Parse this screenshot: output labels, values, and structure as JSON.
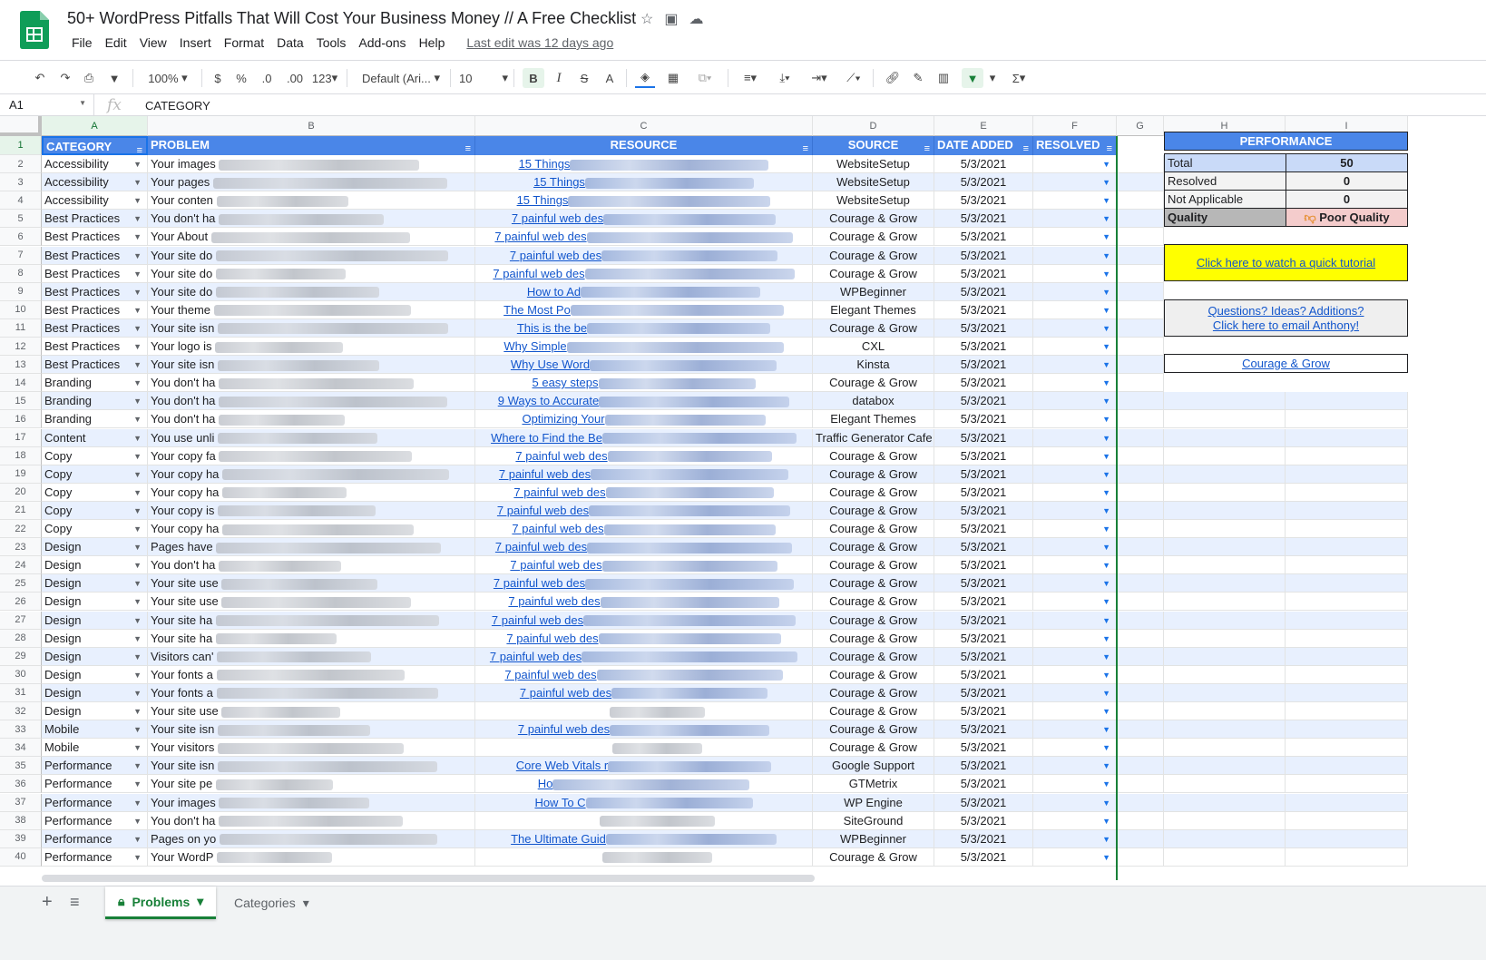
{
  "app": {
    "title": "50+ WordPress Pitfalls That Will Cost Your Business Money // A Free Checklist",
    "menu": [
      "File",
      "Edit",
      "View",
      "Insert",
      "Format",
      "Data",
      "Tools",
      "Add-ons",
      "Help"
    ],
    "last_edit": "Last edit was 12 days ago"
  },
  "toolbar": {
    "zoom": "100%",
    "currency": "$",
    "percent": "%",
    "dec_less": ".0",
    "dec_more": ".00",
    "format_more": "123",
    "font": "Default (Ari...",
    "font_size": "10",
    "bold": "B",
    "italic": "I",
    "strike": "S",
    "text_color": "A",
    "sigma": "Σ"
  },
  "formula_bar": {
    "cell_ref": "A1",
    "fx": "fx",
    "value": "CATEGORY"
  },
  "columns": [
    "A",
    "B",
    "C",
    "D",
    "E",
    "F",
    "G",
    "H",
    "I"
  ],
  "headers": {
    "category": "CATEGORY",
    "problem": "PROBLEM",
    "resource": "RESOURCE",
    "source": "SOURCE",
    "date_added": "DATE ADDED",
    "resolved": "RESOLVED"
  },
  "rows": [
    {
      "n": "2",
      "category": "Accessibility",
      "problem": "Your images",
      "resource": "15 Things",
      "source": "WebsiteSetup",
      "date": "5/3/2021"
    },
    {
      "n": "3",
      "category": "Accessibility",
      "problem": "Your pages",
      "resource": "15 Things",
      "source": "WebsiteSetup",
      "date": "5/3/2021"
    },
    {
      "n": "4",
      "category": "Accessibility",
      "problem": "Your conten",
      "resource": "15 Things",
      "source": "WebsiteSetup",
      "date": "5/3/2021"
    },
    {
      "n": "5",
      "category": "Best Practices",
      "problem": "You don't ha",
      "resource": "7 painful web des",
      "source": "Courage & Grow",
      "date": "5/3/2021"
    },
    {
      "n": "6",
      "category": "Best Practices",
      "problem": "Your About",
      "resource": "7 painful web des",
      "source": "Courage & Grow",
      "date": "5/3/2021"
    },
    {
      "n": "7",
      "category": "Best Practices",
      "problem": "Your site do",
      "resource": "7 painful web des",
      "source": "Courage & Grow",
      "date": "5/3/2021"
    },
    {
      "n": "8",
      "category": "Best Practices",
      "problem": "Your site do",
      "resource": "7 painful web des",
      "source": "Courage & Grow",
      "date": "5/3/2021"
    },
    {
      "n": "9",
      "category": "Best Practices",
      "problem": "Your site do",
      "resource": "How to Ad",
      "source": "WPBeginner",
      "date": "5/3/2021"
    },
    {
      "n": "10",
      "category": "Best Practices",
      "problem": "Your theme",
      "resource": "The Most Po",
      "source": "Elegant Themes",
      "date": "5/3/2021"
    },
    {
      "n": "11",
      "category": "Best Practices",
      "problem": "Your site isn",
      "resource": "This is the be",
      "source": "Courage & Grow",
      "date": "5/3/2021"
    },
    {
      "n": "12",
      "category": "Best Practices",
      "problem": "Your logo is",
      "resource": "Why Simple",
      "source": "CXL",
      "date": "5/3/2021"
    },
    {
      "n": "13",
      "category": "Best Practices",
      "problem": "Your site isn",
      "resource": "Why Use Word",
      "source": "Kinsta",
      "date": "5/3/2021"
    },
    {
      "n": "14",
      "category": "Branding",
      "problem": "You don't ha",
      "resource": "5 easy steps",
      "source": "Courage & Grow",
      "date": "5/3/2021"
    },
    {
      "n": "15",
      "category": "Branding",
      "problem": "You don't ha",
      "resource": "9 Ways to Accurate",
      "source": "databox",
      "date": "5/3/2021"
    },
    {
      "n": "16",
      "category": "Branding",
      "problem": "You don't ha",
      "resource": "Optimizing Your",
      "source": "Elegant Themes",
      "date": "5/3/2021"
    },
    {
      "n": "17",
      "category": "Content",
      "problem": "You use unli",
      "resource": "Where to Find the Be",
      "source": "Traffic Generator Cafe",
      "date": "5/3/2021"
    },
    {
      "n": "18",
      "category": "Copy",
      "problem": "Your copy fa",
      "resource": "7 painful web des",
      "source": "Courage & Grow",
      "date": "5/3/2021"
    },
    {
      "n": "19",
      "category": "Copy",
      "problem": "Your copy ha",
      "resource": "7 painful web des",
      "source": "Courage & Grow",
      "date": "5/3/2021"
    },
    {
      "n": "20",
      "category": "Copy",
      "problem": "Your copy ha",
      "resource": "7 painful web des",
      "source": "Courage & Grow",
      "date": "5/3/2021"
    },
    {
      "n": "21",
      "category": "Copy",
      "problem": "Your copy is",
      "resource": "7 painful web des",
      "source": "Courage & Grow",
      "date": "5/3/2021"
    },
    {
      "n": "22",
      "category": "Copy",
      "problem": "Your copy ha",
      "resource": "7 painful web des",
      "source": "Courage & Grow",
      "date": "5/3/2021"
    },
    {
      "n": "23",
      "category": "Design",
      "problem": "Pages have",
      "resource": "7 painful web des",
      "source": "Courage & Grow",
      "date": "5/3/2021"
    },
    {
      "n": "24",
      "category": "Design",
      "problem": "You don't ha",
      "resource": "7 painful web des",
      "source": "Courage & Grow",
      "date": "5/3/2021"
    },
    {
      "n": "25",
      "category": "Design",
      "problem": "Your site use",
      "resource": "7 painful web des",
      "source": "Courage & Grow",
      "date": "5/3/2021"
    },
    {
      "n": "26",
      "category": "Design",
      "problem": "Your site use",
      "resource": "7 painful web des",
      "source": "Courage & Grow",
      "date": "5/3/2021"
    },
    {
      "n": "27",
      "category": "Design",
      "problem": "Your site ha",
      "resource": "7 painful web des",
      "source": "Courage & Grow",
      "date": "5/3/2021"
    },
    {
      "n": "28",
      "category": "Design",
      "problem": "Your site ha",
      "resource": "7 painful web des",
      "source": "Courage & Grow",
      "date": "5/3/2021"
    },
    {
      "n": "29",
      "category": "Design",
      "problem": "Visitors can'",
      "resource": "7 painful web des",
      "source": "Courage & Grow",
      "date": "5/3/2021"
    },
    {
      "n": "30",
      "category": "Design",
      "problem": "Your fonts a",
      "resource": "7 painful web des",
      "source": "Courage & Grow",
      "date": "5/3/2021"
    },
    {
      "n": "31",
      "category": "Design",
      "problem": "Your fonts a",
      "resource": "7 painful web des",
      "source": "Courage & Grow",
      "date": "5/3/2021"
    },
    {
      "n": "32",
      "category": "Design",
      "problem": "Your site use",
      "resource": "",
      "source": "Courage & Grow",
      "date": "5/3/2021"
    },
    {
      "n": "33",
      "category": "Mobile",
      "problem": "Your site isn",
      "resource": "7 painful web des",
      "source": "Courage & Grow",
      "date": "5/3/2021"
    },
    {
      "n": "34",
      "category": "Mobile",
      "problem": "Your visitors",
      "resource": "",
      "source": "Courage & Grow",
      "date": "5/3/2021"
    },
    {
      "n": "35",
      "category": "Performance",
      "problem": "Your site isn",
      "resource": "Core Web Vitals r",
      "source": "Google Support",
      "date": "5/3/2021"
    },
    {
      "n": "36",
      "category": "Performance",
      "problem": "Your site pe",
      "resource": "Ho",
      "source": "GTMetrix",
      "date": "5/3/2021"
    },
    {
      "n": "37",
      "category": "Performance",
      "problem": "Your images",
      "resource": "How To C",
      "source": "WP Engine",
      "date": "5/3/2021"
    },
    {
      "n": "38",
      "category": "Performance",
      "problem": "You don't ha",
      "resource": "",
      "source": "SiteGround",
      "date": "5/3/2021"
    },
    {
      "n": "39",
      "category": "Performance",
      "problem": "Pages on yo",
      "resource": "The Ultimate Guid",
      "source": "WPBeginner",
      "date": "5/3/2021"
    },
    {
      "n": "40",
      "category": "Performance",
      "problem": "Your WordP",
      "resource": "",
      "source": "Courage & Grow",
      "date": "5/3/2021"
    }
  ],
  "panel": {
    "title": "PERFORMANCE",
    "stats": [
      {
        "label": "Total",
        "value": "50"
      },
      {
        "label": "Resolved",
        "value": "0"
      },
      {
        "label": "Not Applicable",
        "value": "0"
      }
    ],
    "quality_label": "Quality",
    "quality_value": "Poor Quality",
    "tutorial_link": "Click here to watch a quick tutorial",
    "questions_line1": "Questions? Ideas? Additions?",
    "questions_line2": "Click here to email Anthony!",
    "brand_link": "Courage & Grow",
    "colors": {
      "header": "#4a86e8",
      "tutorial_bg": "#ffff00",
      "quality_bg": "#f4cccc",
      "stat_bg": "#c9daf8"
    }
  },
  "sheets": {
    "active": "Problems",
    "other": "Categories"
  },
  "icons": [
    "spreadsheet-logo-icon",
    "star-icon",
    "move-folder-icon",
    "cloud-icon",
    "undo-icon",
    "redo-icon",
    "print-icon",
    "paint-format-icon",
    "fill-color-icon",
    "borders-icon",
    "merge-icon",
    "align-icon",
    "valign-icon",
    "wrap-icon",
    "rotate-icon",
    "link-icon",
    "comment-icon",
    "chart-icon",
    "filter-icon",
    "functions-icon",
    "lock-icon",
    "add-sheet-icon",
    "sheet-list-icon"
  ]
}
